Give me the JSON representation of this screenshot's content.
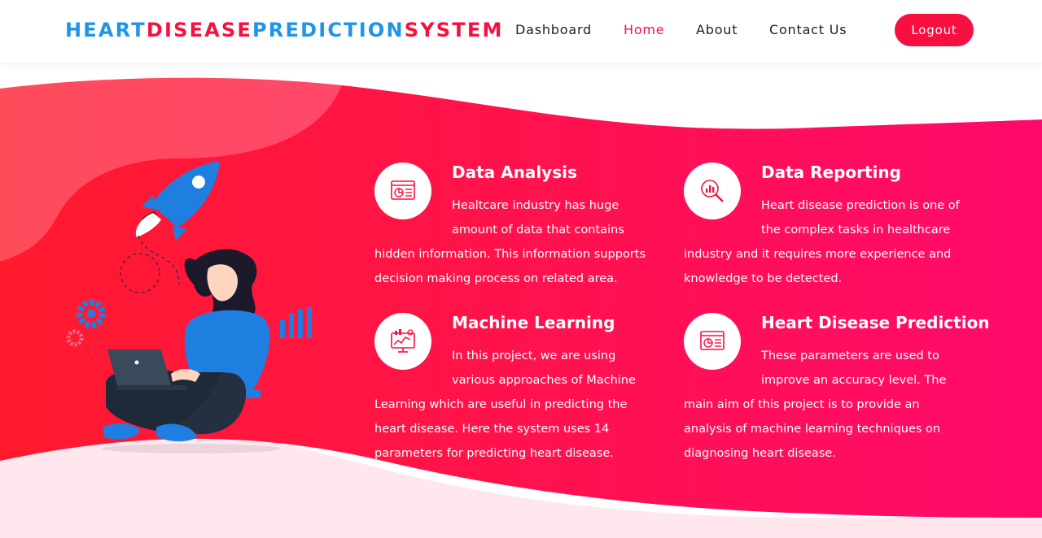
{
  "brand": {
    "parts": [
      {
        "text": "HEART",
        "color": "#1f95e6"
      },
      {
        "text": "DISEASE",
        "color": "#f7103f"
      },
      {
        "text": "PREDICTION",
        "color": "#1f95e6"
      },
      {
        "text": "SYSTEM",
        "color": "#f7103f"
      }
    ]
  },
  "nav": {
    "dashboard": "Dashboard",
    "home": "Home",
    "about": "About",
    "contact": "Contact Us",
    "logout": "Logout"
  },
  "colors": {
    "accent": "#f7103f",
    "brand_blue": "#1f95e6",
    "hero_start": "#ff1a2d",
    "hero_end": "#ff0a6c"
  },
  "features": [
    {
      "title": "Data Analysis",
      "icon": "chart-report-icon",
      "desc": "Healtcare industry has huge amount of data that contains hidden information. This information supports decision making process on related area."
    },
    {
      "title": "Data Reporting",
      "icon": "magnifier-chart-icon",
      "desc": "Heart disease prediction is one of the complex tasks in healthcare industry and it requires more experience and knowledge to be detected."
    },
    {
      "title": "Machine Learning",
      "icon": "monitor-analytics-icon",
      "desc": "In this project, we are using various approaches of Machine Learning which are useful in predicting the heart disease. Here the system uses 14 parameters for predicting heart disease."
    },
    {
      "title": "Heart Disease Prediction",
      "icon": "chart-report-icon",
      "desc": "These parameters are used to improve an accuracy level. The main aim of this project is to provide an analysis of machine learning techniques on diagnosing heart disease."
    }
  ]
}
